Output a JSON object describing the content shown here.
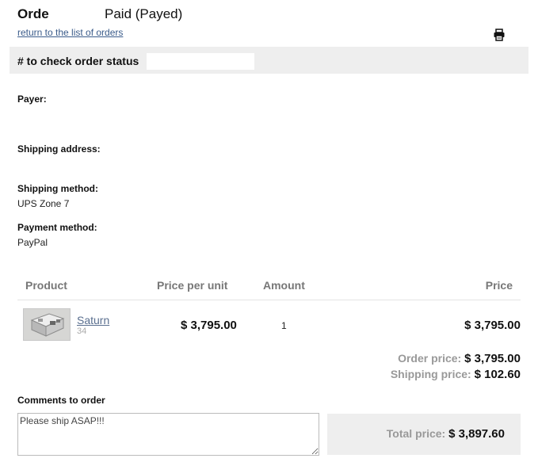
{
  "header": {
    "title": "Orde",
    "status": "Paid (Payed)",
    "back_link": "return to the list of orders",
    "print_icon": "printer-icon"
  },
  "check_status": {
    "label": "# to check order status",
    "value": ""
  },
  "fields": {
    "payer_label": "Payer:",
    "payer_value": "",
    "shipping_address_label": "Shipping address:",
    "shipping_address_value": "",
    "shipping_method_label": "Shipping method:",
    "shipping_method_value": "UPS Zone 7",
    "payment_method_label": "Payment method:",
    "payment_method_value": "PayPal"
  },
  "table": {
    "columns": [
      "Product",
      "Price per unit",
      "Amount",
      "Price"
    ],
    "rows": [
      {
        "name": "Saturn",
        "sku": "34",
        "unit_price": "$ 3,795.00",
        "amount": "1",
        "price": "$ 3,795.00"
      }
    ]
  },
  "summary": {
    "order_price_label": "Order price:",
    "order_price": "$ 3,795.00",
    "shipping_price_label": "Shipping price:",
    "shipping_price": "$ 102.60",
    "total_label": "Total price:",
    "total": "$ 3,897.60"
  },
  "comments": {
    "label": "Comments to order",
    "value": "Please ship ASAP!!!"
  }
}
